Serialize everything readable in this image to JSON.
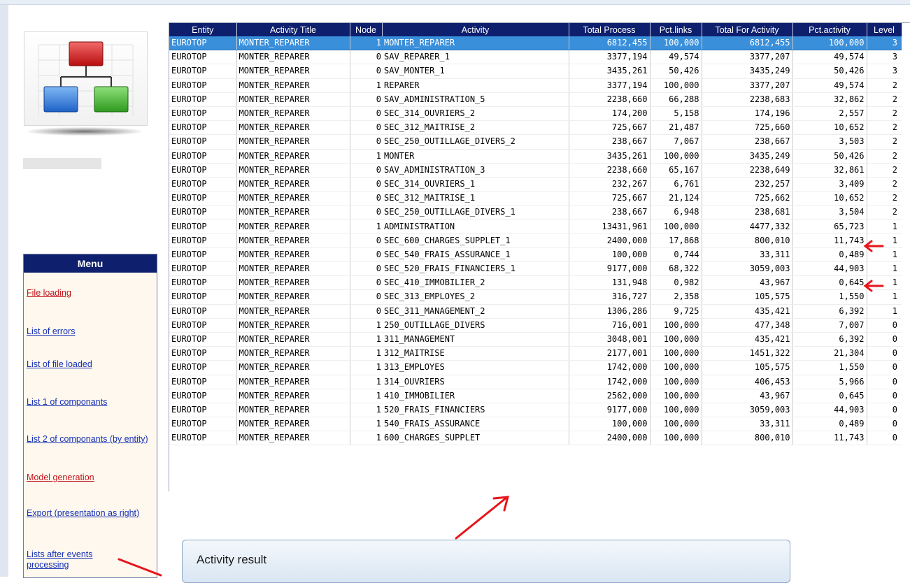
{
  "columns": [
    "Entity",
    "Activity Title",
    "Node",
    "Activity",
    "Total Process",
    "Pct.links",
    "Total For Activity",
    "Pct.activity",
    "Level"
  ],
  "rows": [
    [
      "EUROTOP",
      "MONTER_REPARER",
      "1",
      "MONTER_REPARER",
      "6812,455",
      "100,000",
      "6812,455",
      "100,000",
      "3"
    ],
    [
      "EUROTOP",
      "MONTER_REPARER",
      "0",
      "SAV_REPARER_1",
      "3377,194",
      "49,574",
      "3377,207",
      "49,574",
      "3"
    ],
    [
      "EUROTOP",
      "MONTER_REPARER",
      "0",
      "SAV_MONTER_1",
      "3435,261",
      "50,426",
      "3435,249",
      "50,426",
      "3"
    ],
    [
      "EUROTOP",
      "MONTER_REPARER",
      "1",
      "REPARER",
      "3377,194",
      "100,000",
      "3377,207",
      "49,574",
      "2"
    ],
    [
      "EUROTOP",
      "MONTER_REPARER",
      "0",
      "SAV_ADMINISTRATION_5",
      "2238,660",
      "66,288",
      "2238,683",
      "32,862",
      "2"
    ],
    [
      "EUROTOP",
      "MONTER_REPARER",
      "0",
      "SEC_314_OUVRIERS_2",
      "174,200",
      "5,158",
      "174,196",
      "2,557",
      "2"
    ],
    [
      "EUROTOP",
      "MONTER_REPARER",
      "0",
      "SEC_312_MAITRISE_2",
      "725,667",
      "21,487",
      "725,660",
      "10,652",
      "2"
    ],
    [
      "EUROTOP",
      "MONTER_REPARER",
      "0",
      "SEC_250_OUTILLAGE_DIVERS_2",
      "238,667",
      "7,067",
      "238,667",
      "3,503",
      "2"
    ],
    [
      "EUROTOP",
      "MONTER_REPARER",
      "1",
      "MONTER",
      "3435,261",
      "100,000",
      "3435,249",
      "50,426",
      "2"
    ],
    [
      "EUROTOP",
      "MONTER_REPARER",
      "0",
      "SAV_ADMINISTRATION_3",
      "2238,660",
      "65,167",
      "2238,649",
      "32,861",
      "2"
    ],
    [
      "EUROTOP",
      "MONTER_REPARER",
      "0",
      "SEC_314_OUVRIERS_1",
      "232,267",
      "6,761",
      "232,257",
      "3,409",
      "2"
    ],
    [
      "EUROTOP",
      "MONTER_REPARER",
      "0",
      "SEC_312_MAITRISE_1",
      "725,667",
      "21,124",
      "725,662",
      "10,652",
      "2"
    ],
    [
      "EUROTOP",
      "MONTER_REPARER",
      "0",
      "SEC_250_OUTILLAGE_DIVERS_1",
      "238,667",
      "6,948",
      "238,681",
      "3,504",
      "2"
    ],
    [
      "EUROTOP",
      "MONTER_REPARER",
      "1",
      "ADMINISTRATION",
      "13431,961",
      "100,000",
      "4477,332",
      "65,723",
      "1"
    ],
    [
      "EUROTOP",
      "MONTER_REPARER",
      "0",
      "SEC_600_CHARGES_SUPPLET_1",
      "2400,000",
      "17,868",
      "800,010",
      "11,743",
      "1"
    ],
    [
      "EUROTOP",
      "MONTER_REPARER",
      "0",
      "SEC_540_FRAIS_ASSURANCE_1",
      "100,000",
      "0,744",
      "33,311",
      "0,489",
      "1"
    ],
    [
      "EUROTOP",
      "MONTER_REPARER",
      "0",
      "SEC_520_FRAIS_FINANCIERS_1",
      "9177,000",
      "68,322",
      "3059,003",
      "44,903",
      "1"
    ],
    [
      "EUROTOP",
      "MONTER_REPARER",
      "0",
      "SEC_410_IMMOBILIER_2",
      "131,948",
      "0,982",
      "43,967",
      "0,645",
      "1"
    ],
    [
      "EUROTOP",
      "MONTER_REPARER",
      "0",
      "SEC_313_EMPLOYES_2",
      "316,727",
      "2,358",
      "105,575",
      "1,550",
      "1"
    ],
    [
      "EUROTOP",
      "MONTER_REPARER",
      "0",
      "SEC_311_MANAGEMENT_2",
      "1306,286",
      "9,725",
      "435,421",
      "6,392",
      "1"
    ],
    [
      "EUROTOP",
      "MONTER_REPARER",
      "1",
      "250_OUTILLAGE_DIVERS",
      "716,001",
      "100,000",
      "477,348",
      "7,007",
      "0"
    ],
    [
      "EUROTOP",
      "MONTER_REPARER",
      "1",
      "311_MANAGEMENT",
      "3048,001",
      "100,000",
      "435,421",
      "6,392",
      "0"
    ],
    [
      "EUROTOP",
      "MONTER_REPARER",
      "1",
      "312_MAITRISE",
      "2177,001",
      "100,000",
      "1451,322",
      "21,304",
      "0"
    ],
    [
      "EUROTOP",
      "MONTER_REPARER",
      "1",
      "313_EMPLOYES",
      "1742,000",
      "100,000",
      "105,575",
      "1,550",
      "0"
    ],
    [
      "EUROTOP",
      "MONTER_REPARER",
      "1",
      "314_OUVRIERS",
      "1742,000",
      "100,000",
      "406,453",
      "5,966",
      "0"
    ],
    [
      "EUROTOP",
      "MONTER_REPARER",
      "1",
      "410_IMMOBILIER",
      "2562,000",
      "100,000",
      "43,967",
      "0,645",
      "0"
    ],
    [
      "EUROTOP",
      "MONTER_REPARER",
      "1",
      "520_FRAIS_FINANCIERS",
      "9177,000",
      "100,000",
      "3059,003",
      "44,903",
      "0"
    ],
    [
      "EUROTOP",
      "MONTER_REPARER",
      "1",
      "540_FRAIS_ASSURANCE",
      "100,000",
      "100,000",
      "33,311",
      "0,489",
      "0"
    ],
    [
      "EUROTOP",
      "MONTER_REPARER",
      "1",
      "600_CHARGES_SUPPLET",
      "2400,000",
      "100,000",
      "800,010",
      "11,743",
      "0"
    ]
  ],
  "selected_row": 0,
  "menu": {
    "title": "Menu",
    "items": [
      {
        "label": "File loading"
      },
      {
        "label": "List of errors"
      },
      {
        "label": "List of file loaded"
      },
      {
        "label": "List 1 of componants"
      },
      {
        "label": "List 2 of componants (by entity)"
      },
      {
        "label": "Model generation"
      },
      {
        "label": "Export (presentation as right)"
      },
      {
        "label": "Lists after events processing"
      }
    ]
  },
  "dialog": {
    "title": "Activity result"
  },
  "icons": {
    "logo": "org-chart-icon",
    "annotation": "red-arrow-icon"
  },
  "colors": {
    "header_bg": "#0d1f6d",
    "selected_row": "#3a8fdb",
    "annotation": "#e8141b",
    "link_red": "#c0141b",
    "link_blue": "#1530b5"
  }
}
